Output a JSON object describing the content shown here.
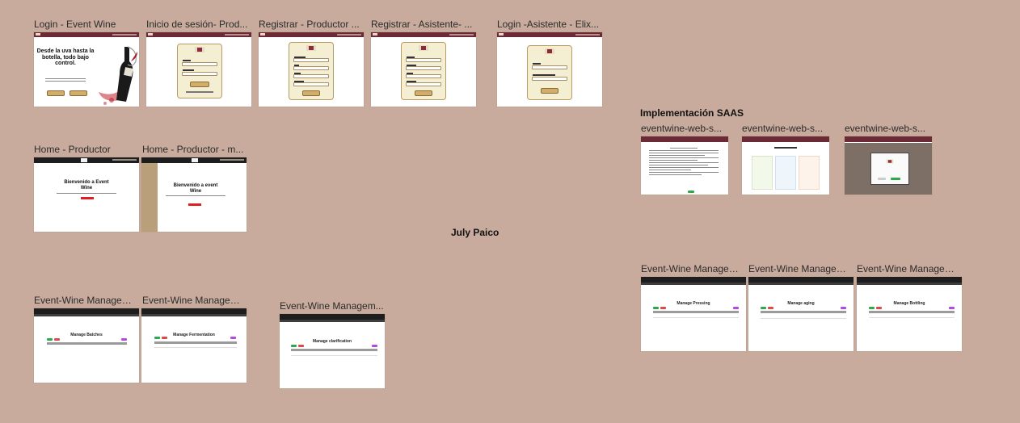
{
  "canvas": {
    "background": "#c8ab9c",
    "owner_label": "July Paico",
    "section_title": "Implementación SAAS"
  },
  "frames": {
    "login_event_wine": {
      "label": "Login - Event Wine",
      "hero_title": "Desde la uva hasta la botella, todo bajo control."
    },
    "inicio_sesion_productor": {
      "label": "Inicio de sesión- Prod..."
    },
    "registrar_productor": {
      "label": "Registrar - Productor ..."
    },
    "registrar_asistente": {
      "label": "Registrar - Asistente- ..."
    },
    "login_asistente": {
      "label": "Login -Asistente - Elix..."
    },
    "home_productor": {
      "label": "Home - Productor",
      "hero_title": "Bienvenido a Event Wine"
    },
    "home_productor_menu": {
      "label": "Home - Productor - m...",
      "hero_title": "Bienvenido a event Wine"
    },
    "manage_batches": {
      "label": "Event-Wine Managem...",
      "page_title": "Manage Batches"
    },
    "manage_fermentation": {
      "label": "Event-Wine Managem...",
      "page_title": "Manage Fermentation"
    },
    "manage_clarification": {
      "label": "Event-Wine Managem...",
      "page_title": "Manage clarification"
    },
    "saas_1": {
      "label": "eventwine-web-s..."
    },
    "saas_2": {
      "label": "eventwine-web-s..."
    },
    "saas_3": {
      "label": "eventwine-web-s..."
    },
    "manage_pressing": {
      "label": "Event-Wine Managem...",
      "page_title": "Manage Pressing"
    },
    "manage_aging": {
      "label": "Event-Wine Managem...",
      "page_title": "Manage aging"
    },
    "manage_bottling": {
      "label": "Event-Wine Managem...",
      "page_title": "Manage Bottling"
    }
  }
}
